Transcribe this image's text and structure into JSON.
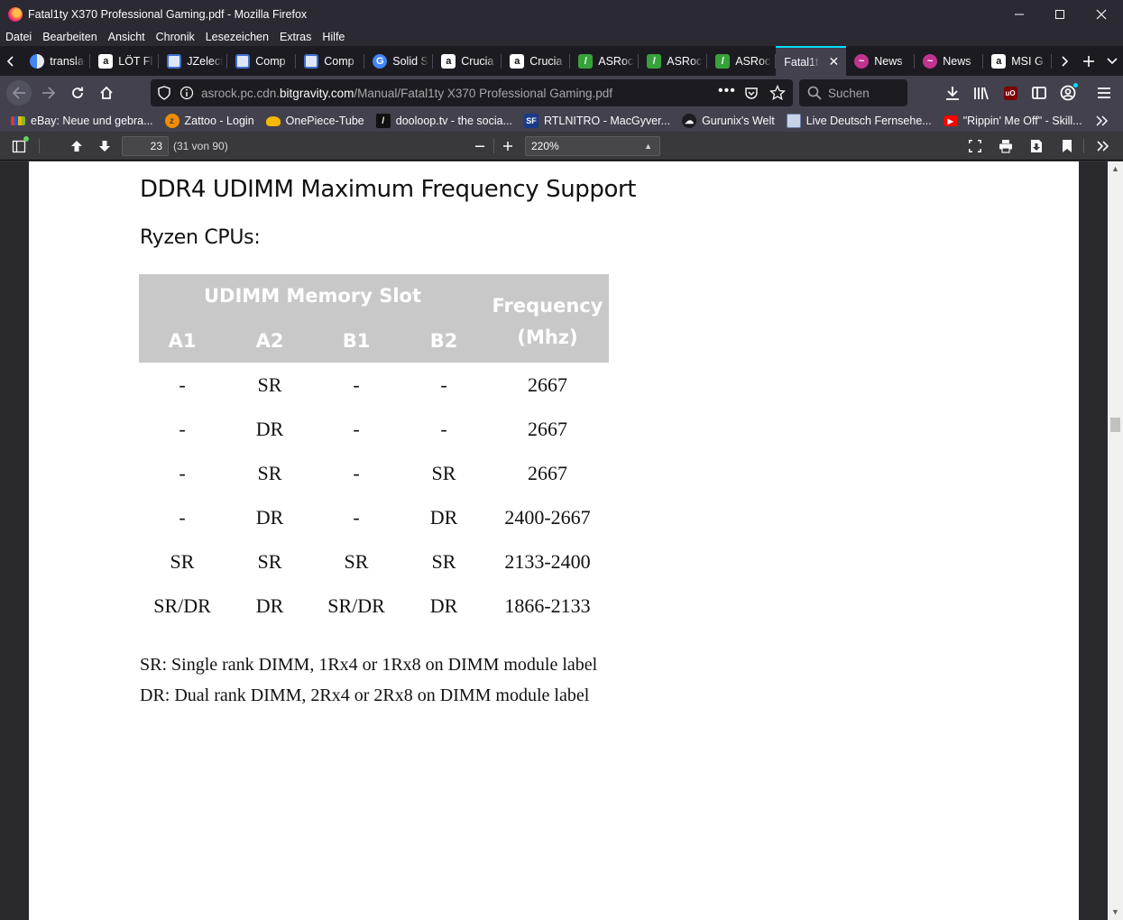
{
  "window": {
    "title": "Fatal1ty X370 Professional Gaming.pdf - Mozilla Firefox"
  },
  "menu": [
    "Datei",
    "Bearbeiten",
    "Ansicht",
    "Chronik",
    "Lesezeichen",
    "Extras",
    "Hilfe"
  ],
  "tabs": [
    {
      "label": "transla",
      "icon": "translate-icon",
      "color": "#4285f4"
    },
    {
      "label": "LÖT Fl",
      "icon": "amazon-icon",
      "color": "#ffffff"
    },
    {
      "label": "JZelect",
      "icon": "site-icon",
      "color": "#3f6fcf"
    },
    {
      "label": "Comp",
      "icon": "site-icon",
      "color": "#3f6fcf"
    },
    {
      "label": "Comp",
      "icon": "site-icon",
      "color": "#3f6fcf"
    },
    {
      "label": "Solid S",
      "icon": "google-icon",
      "color": "#4285f4"
    },
    {
      "label": "Crucia",
      "icon": "amazon-icon",
      "color": "#ffffff"
    },
    {
      "label": "Crucia",
      "icon": "amazon-icon",
      "color": "#ffffff"
    },
    {
      "label": "ASRoc",
      "icon": "asrock-icon",
      "color": "#38a23a"
    },
    {
      "label": "ASRoc",
      "icon": "asrock-icon",
      "color": "#38a23a"
    },
    {
      "label": "ASRoc",
      "icon": "asrock-icon",
      "color": "#38a23a"
    },
    {
      "label": "Fatal1ty",
      "icon": "pdf-icon",
      "color": "#42414d",
      "active": true
    },
    {
      "label": "News",
      "icon": "news-icon",
      "color": "#c2338f"
    },
    {
      "label": "News",
      "icon": "news-icon",
      "color": "#c2338f"
    },
    {
      "label": "MSI G",
      "icon": "amazon-icon",
      "color": "#ffffff"
    }
  ],
  "urlbar": {
    "prefix": "asrock.pc.cdn.",
    "host": "bitgravity.com",
    "path": "/Manual/Fatal1ty X370 Professional Gaming.pdf"
  },
  "search": {
    "placeholder": "Suchen"
  },
  "bookmarks": [
    {
      "label": "eBay: Neue und gebra...",
      "icon": "ebay-icon"
    },
    {
      "label": "Zattoo - Login",
      "icon": "zattoo-icon"
    },
    {
      "label": "OnePiece-Tube",
      "icon": "onepiece-icon"
    },
    {
      "label": "dooloop.tv - the socia...",
      "icon": "dooloop-icon"
    },
    {
      "label": "RTLNITRO - MacGyver...",
      "icon": "sf-icon"
    },
    {
      "label": "Gurunix's Welt",
      "icon": "gurunix-icon"
    },
    {
      "label": "Live Deutsch Fernsehe...",
      "icon": "tv-icon"
    },
    {
      "label": "\"Rippin' Me Off\" - Skill...",
      "icon": "youtube-icon"
    }
  ],
  "pdf_toolbar": {
    "page_number": "23",
    "page_count": "(31 von 90)",
    "zoom": "220%"
  },
  "document": {
    "heading": "DDR4 UDIMM Maximum Frequency Support",
    "subheading": "Ryzen CPUs:",
    "table": {
      "group_header": "UDIMM Memory Slot",
      "freq_header_line1": "Frequency",
      "freq_header_line2": "(Mhz)",
      "columns": [
        "A1",
        "A2",
        "B1",
        "B2"
      ],
      "rows": [
        {
          "a1": "-",
          "a2": "SR",
          "b1": "-",
          "b2": "-",
          "freq": "2667"
        },
        {
          "a1": "-",
          "a2": "DR",
          "b1": "-",
          "b2": "-",
          "freq": "2667"
        },
        {
          "a1": "-",
          "a2": "SR",
          "b1": "-",
          "b2": "SR",
          "freq": "2667"
        },
        {
          "a1": "-",
          "a2": "DR",
          "b1": "-",
          "b2": "DR",
          "freq": "2400-2667"
        },
        {
          "a1": "SR",
          "a2": "SR",
          "b1": "SR",
          "b2": "SR",
          "freq": "2133-2400"
        },
        {
          "a1": "SR/DR",
          "a2": "DR",
          "b1": "SR/DR",
          "b2": "DR",
          "freq": "1866-2133"
        }
      ]
    },
    "notes": [
      "SR: Single rank DIMM, 1Rx4 or 1Rx8 on DIMM module label",
      "DR: Dual rank DIMM, 2Rx4 or 2Rx8 on DIMM module label"
    ]
  }
}
